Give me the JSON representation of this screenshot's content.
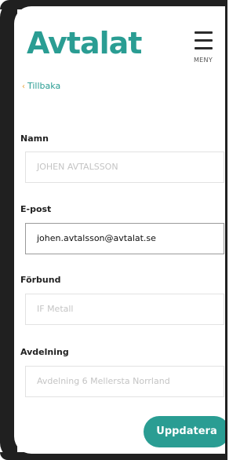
{
  "header": {
    "logo_text": "Avtalat",
    "menu_label": "MENY"
  },
  "nav": {
    "back_arrow": "‹",
    "back_label": "Tillbaka"
  },
  "form": {
    "name": {
      "label": "Namn",
      "value": "JOHEN AVTALSSON"
    },
    "email": {
      "label": "E-post",
      "value": "johen.avtalsson@avtalat.se"
    },
    "union": {
      "label": "Förbund",
      "value": "IF Metall"
    },
    "department": {
      "label": "Avdelning",
      "value": "Avdelning 6 Mellersta Norrland"
    }
  },
  "actions": {
    "update_label": "Uppdatera"
  },
  "colors": {
    "brand": "#2a9d93",
    "back_arrow": "#e8a23a",
    "frame": "#202020"
  }
}
